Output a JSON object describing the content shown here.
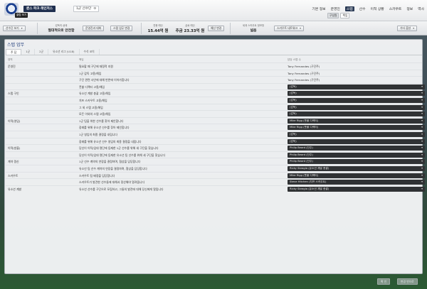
{
  "header": {
    "crest_tooltip": "클럽 보기",
    "team_name": "퀸스 파크 레인저스",
    "squad": "1군 선수단",
    "squad_icon": "gear-icon",
    "nav": [
      "기본 정보",
      "운영진",
      "스탭",
      "선수",
      "이적 상황",
      "스카우트",
      "정보",
      "역사"
    ],
    "active_nav": "스탭",
    "subnav": [
      "구성원",
      "책임"
    ],
    "active_subnav": "책임"
  },
  "infobar": {
    "squad_view_button": "선수단 보기",
    "board_status_label": "감독의 상태",
    "board_status_value": "절대적으로 안전함",
    "board_info_button": "운영진과 대화",
    "staff_search_button": "스탭 업무 변경",
    "wage_budget_label": "연봉 예산",
    "wage_budget_value": "15.44억 원",
    "wage_add_label": "급료 예산",
    "wage_add_value": "추금 23.33억 원",
    "budget_change_button": "예산 변경",
    "scout_label": "세계 스카우트 정보망",
    "scout_value": "넓음",
    "scout_network_button": "스카우트 네트워크",
    "other_options_button": "기타 옵션"
  },
  "panel": {
    "title": "스탭 업무",
    "tabs": [
      "주 담",
      "1군",
      "2군",
      "유소년 리그 (U18)",
      "수석 코치"
    ],
    "active_tab": 0,
    "col_area": "영역",
    "col_responsibility": "책임",
    "col_staff": "담당 스탭 수"
  },
  "rows": [
    {
      "area": "운영진",
      "resp": "필요할 때 구단에 재정적 지원",
      "staff": "Tony Fernandes (구단주)",
      "dropdown": false
    },
    {
      "area": "",
      "resp": "1군 감독 고용/해임",
      "staff": "Tony Fernandes (구단주)",
      "dropdown": false
    },
    {
      "area": "",
      "resp": "구단 관련 사안에 대해 반론에 이어가합니다",
      "staff": "Tony Fernandes (구단주)",
      "dropdown": false
    },
    {
      "area": "",
      "resp": "풋볼 디렉터 고용/해임",
      "staff": "(감독)",
      "dropdown": true
    },
    {
      "area": "스탭 구인",
      "resp": "유소년 계발 총괄 고용/해임",
      "staff": "(감독)",
      "dropdown": true
    },
    {
      "area": "",
      "resp": "치프 스카우트 고용/해임",
      "staff": "(감독)",
      "dropdown": true
    },
    {
      "area": "",
      "resp": "그 외 스탭 고용/해임",
      "staff": "(감독)",
      "dropdown": true
    },
    {
      "area": "",
      "resp": "모든 이외의 스탭 고용/해임",
      "staff": "(감독)",
      "dropdown": true
    },
    {
      "area": "이적(영입)",
      "resp": "1군 팀을 위한 선수를 찾아 제안합니다",
      "staff": "Mike Rigg (풋볼 디렉터)",
      "dropdown": true
    },
    {
      "area": "",
      "resp": "장래를 위해 유소년 선수를 찾아 제안합니다",
      "staff": "Mike Rigg (풋볼 디렉터)",
      "dropdown": true
    },
    {
      "area": "",
      "resp": "1군 영입의 최종 결정을 내립니다",
      "staff": "(감독)",
      "dropdown": true
    },
    {
      "area": "",
      "resp": "장래를 위해 유소년 선수 영입의 최종 결정을 내립니다",
      "staff": "(감독)",
      "dropdown": true
    },
    {
      "area": "이적(방출)",
      "resp": "당신이 이적/임대 명단에 등재한 1군 선수를 위해 새 구단을 찾습니다",
      "staff": "Philip Beard (단주)",
      "dropdown": true
    },
    {
      "area": "",
      "resp": "당신이 이적/임대 명단에 등재한 유소년 팀 선수를 위해 새 구단을 찾습니다",
      "staff": "Philip Beard (단주)",
      "dropdown": true
    },
    {
      "area": "계약 갱신",
      "resp": "1군 선수 계약의 연장을 결정하며, 협상을 담당합니다",
      "staff": "Philip Beard (단주)",
      "dropdown": true
    },
    {
      "area": "",
      "resp": "유소년 팀 선수 계약의 연장을 결정하며, 협상을 담당합니다",
      "staff": "Ricky Sbragia (유소년 계발 총괄)",
      "dropdown": true
    },
    {
      "area": "스카우트",
      "resp": "스카우트 팀 배정을 담당합니다",
      "staff": "Mike Rigg (풋볼 디렉터)",
      "dropdown": true
    },
    {
      "area": "",
      "resp": "스카우트가 발견한 선수들에 대해서 정산해야 알려줍니다",
      "staff": "Steve Hitchen (치프 스카우트)",
      "dropdown": true
    },
    {
      "area": "유소년 계발",
      "resp": "유소년 선수를 구단으로 모집하고, 그들의 발전에 대해 당신에게 알립니다",
      "staff": "Ricky Sbragia (유소년 계발 총괄)",
      "dropdown": true
    }
  ],
  "footer": {
    "confirm_button": "확 인",
    "change_button": "변경 반으로"
  }
}
